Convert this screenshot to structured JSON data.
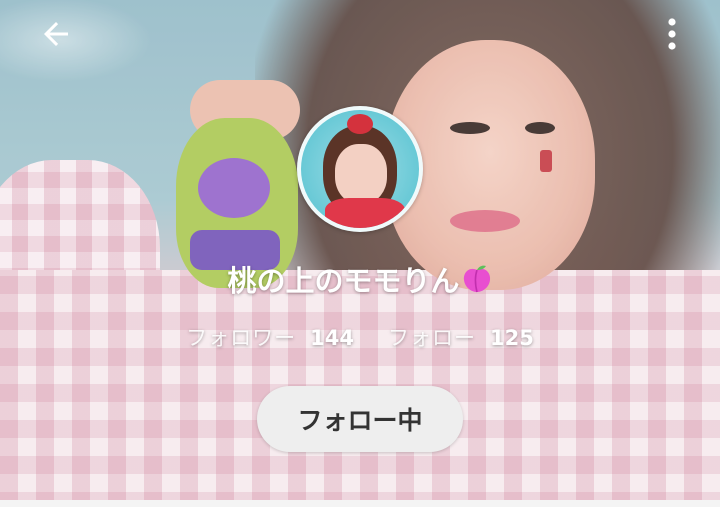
{
  "profile": {
    "display_name": "桃の上のモモりん",
    "name_emoji": "peach-icon",
    "followers_label": "フォロワー",
    "followers_count": "144",
    "following_label": "フォロー",
    "following_count": "125",
    "follow_button_label": "フォロー中"
  },
  "toolbar": {
    "back_icon": "arrow-left-icon",
    "menu_icon": "more-vertical-icon"
  },
  "colors": {
    "name_text": "#ffffff",
    "button_bg": "#eeeeee",
    "button_text": "#333333",
    "peach": "#e84fd0"
  }
}
